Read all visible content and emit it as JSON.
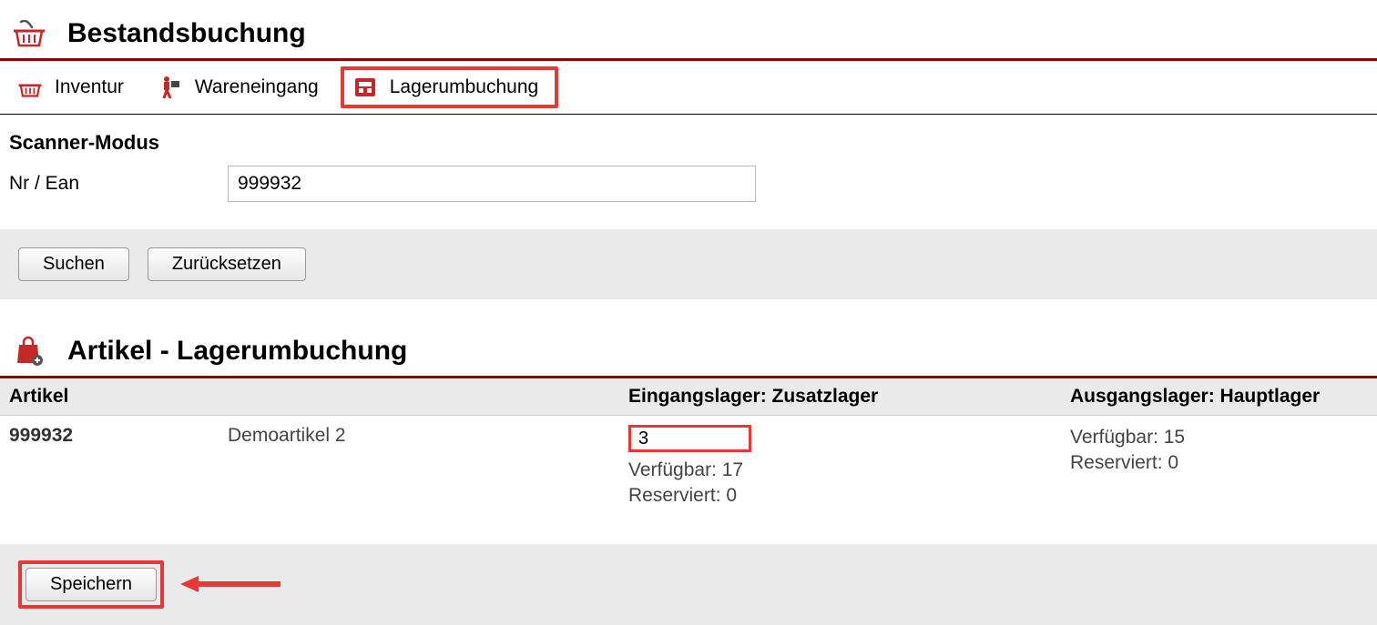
{
  "page": {
    "title": "Bestandsbuchung"
  },
  "tabs": {
    "inventory": "Inventur",
    "incoming": "Wareneingang",
    "transfer": "Lagerumbuchung"
  },
  "scanner": {
    "heading": "Scanner-Modus",
    "label": "Nr / Ean",
    "value": "999932"
  },
  "buttons": {
    "search": "Suchen",
    "reset": "Zurücksetzen",
    "save": "Speichern"
  },
  "article": {
    "heading": "Artikel - Lagerumbuchung",
    "columns": {
      "article": "Artikel",
      "incoming": "Eingangslager: Zusatzlager",
      "outgoing": "Ausgangslager: Hauptlager"
    },
    "row": {
      "number": "999932",
      "name": "Demoartikel 2",
      "qty": "3",
      "in_available": "Verfügbar: 17",
      "in_reserved": "Reserviert: 0",
      "out_available": "Verfügbar: 15",
      "out_reserved": "Reserviert: 0"
    }
  }
}
